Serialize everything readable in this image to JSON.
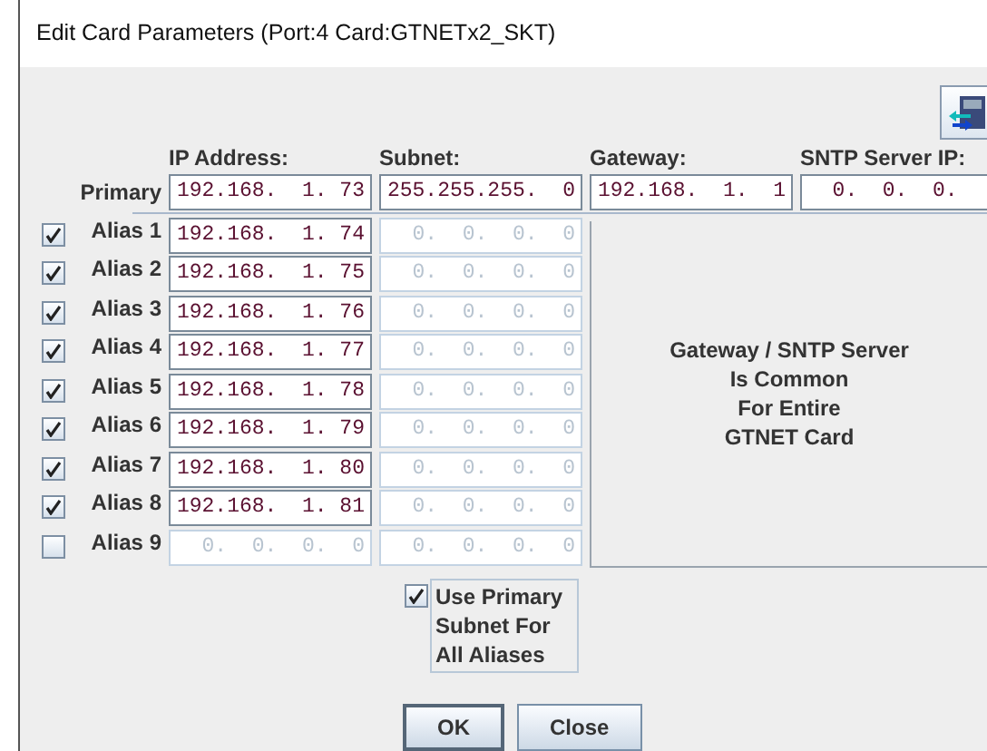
{
  "window": {
    "title": "Edit Card Parameters (Port:4 Card:GTNETx2_SKT)"
  },
  "columns": [
    "IP Address:",
    "Subnet:",
    "Gateway:",
    "SNTP Server IP:"
  ],
  "primary": {
    "label": "Primary",
    "fields": [
      {
        "value": "192.168.  1. 73",
        "disabled": false
      },
      {
        "value": "255.255.255.  0",
        "disabled": false
      },
      {
        "value": "192.168.  1.  1",
        "disabled": false
      },
      {
        "value": "  0.  0.  0.",
        "disabled": false
      }
    ]
  },
  "aliases": [
    {
      "label": "Alias 1",
      "checked": true,
      "ip": {
        "value": "192.168.  1. 74",
        "disabled": false
      },
      "subnet": {
        "value": "  0.  0.  0.  0",
        "disabled": true
      }
    },
    {
      "label": "Alias 2",
      "checked": true,
      "ip": {
        "value": "192.168.  1. 75",
        "disabled": false
      },
      "subnet": {
        "value": "  0.  0.  0.  0",
        "disabled": true
      }
    },
    {
      "label": "Alias 3",
      "checked": true,
      "ip": {
        "value": "192.168.  1. 76",
        "disabled": false
      },
      "subnet": {
        "value": "  0.  0.  0.  0",
        "disabled": true
      }
    },
    {
      "label": "Alias 4",
      "checked": true,
      "ip": {
        "value": "192.168.  1. 77",
        "disabled": false
      },
      "subnet": {
        "value": "  0.  0.  0.  0",
        "disabled": true
      }
    },
    {
      "label": "Alias 5",
      "checked": true,
      "ip": {
        "value": "192.168.  1. 78",
        "disabled": false
      },
      "subnet": {
        "value": "  0.  0.  0.  0",
        "disabled": true
      }
    },
    {
      "label": "Alias 6",
      "checked": true,
      "ip": {
        "value": "192.168.  1. 79",
        "disabled": false
      },
      "subnet": {
        "value": "  0.  0.  0.  0",
        "disabled": true
      }
    },
    {
      "label": "Alias 7",
      "checked": true,
      "ip": {
        "value": "192.168.  1. 80",
        "disabled": false
      },
      "subnet": {
        "value": "  0.  0.  0.  0",
        "disabled": true
      }
    },
    {
      "label": "Alias 8",
      "checked": true,
      "ip": {
        "value": "192.168.  1. 81",
        "disabled": false
      },
      "subnet": {
        "value": "  0.  0.  0.  0",
        "disabled": true
      }
    },
    {
      "label": "Alias 9",
      "checked": false,
      "ip": {
        "value": "  0.  0.  0.  0",
        "disabled": true
      },
      "subnet": {
        "value": "  0.  0.  0.  0",
        "disabled": true
      }
    }
  ],
  "common_note": "Gateway / SNTP Server\nIs Common\nFor Entire\nGTNET Card",
  "use_primary_subnet": {
    "label": "Use Primary Subnet For All Aliases",
    "checked": true
  },
  "buttons": [
    {
      "label": "OK"
    },
    {
      "label": "Close"
    }
  ]
}
